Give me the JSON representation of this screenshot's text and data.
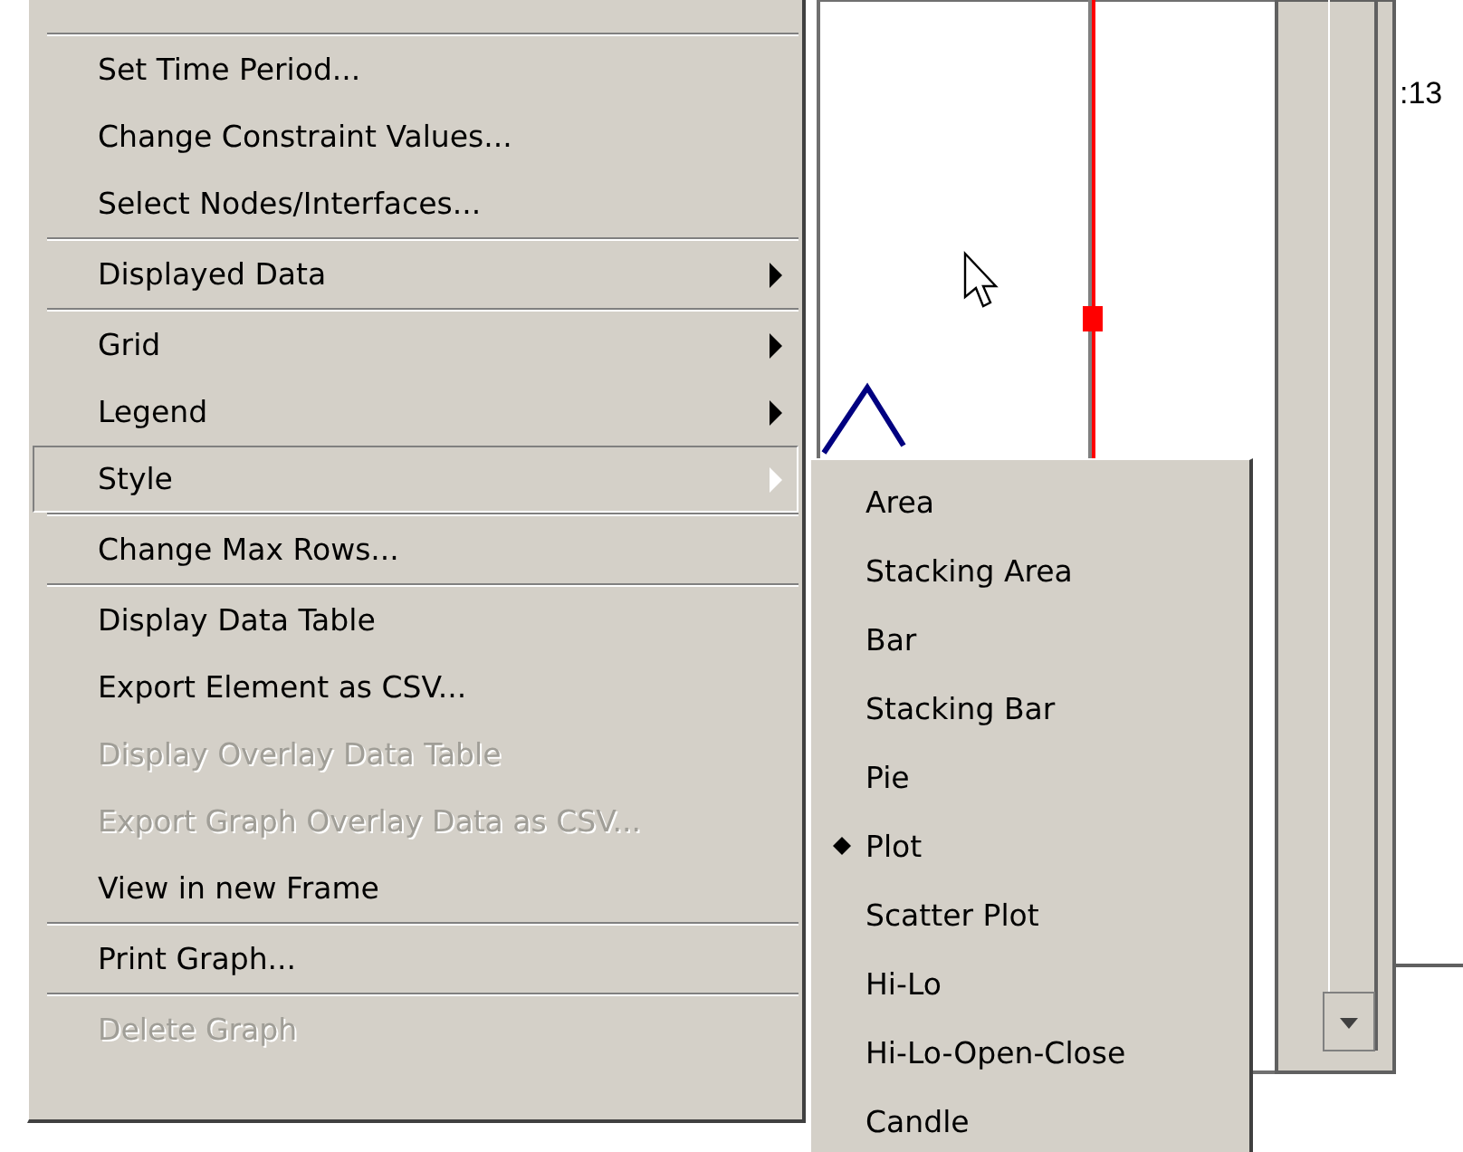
{
  "background": {
    "labels": [
      {
        "text": ":13"
      }
    ]
  },
  "menu": {
    "items": [
      {
        "kind": "separator"
      },
      {
        "kind": "item",
        "label": "Set Time Period...",
        "disabled": false,
        "submenu": false,
        "selected": false
      },
      {
        "kind": "item",
        "label": "Change Constraint Values...",
        "disabled": false,
        "submenu": false,
        "selected": false
      },
      {
        "kind": "item",
        "label": "Select Nodes/Interfaces...",
        "disabled": false,
        "submenu": false,
        "selected": false
      },
      {
        "kind": "separator"
      },
      {
        "kind": "item",
        "label": "Displayed Data",
        "disabled": false,
        "submenu": true,
        "selected": false
      },
      {
        "kind": "separator"
      },
      {
        "kind": "item",
        "label": "Grid",
        "disabled": false,
        "submenu": true,
        "selected": false
      },
      {
        "kind": "item",
        "label": "Legend",
        "disabled": false,
        "submenu": true,
        "selected": false
      },
      {
        "kind": "item",
        "label": "Style",
        "disabled": false,
        "submenu": true,
        "selected": true
      },
      {
        "kind": "separator"
      },
      {
        "kind": "item",
        "label": "Change Max Rows...",
        "disabled": false,
        "submenu": false,
        "selected": false
      },
      {
        "kind": "separator"
      },
      {
        "kind": "item",
        "label": "Display Data Table",
        "disabled": false,
        "submenu": false,
        "selected": false
      },
      {
        "kind": "item",
        "label": "Export Element as CSV...",
        "disabled": false,
        "submenu": false,
        "selected": false
      },
      {
        "kind": "item",
        "label": "Display Overlay Data Table",
        "disabled": true,
        "submenu": false,
        "selected": false
      },
      {
        "kind": "item",
        "label": "Export Graph Overlay Data as CSV...",
        "disabled": true,
        "submenu": false,
        "selected": false
      },
      {
        "kind": "item",
        "label": "View in new Frame",
        "disabled": false,
        "submenu": false,
        "selected": false
      },
      {
        "kind": "separator"
      },
      {
        "kind": "item",
        "label": "Print Graph...",
        "disabled": false,
        "submenu": false,
        "selected": false
      },
      {
        "kind": "separator"
      },
      {
        "kind": "item",
        "label": "Delete Graph",
        "disabled": true,
        "submenu": false,
        "selected": false
      }
    ]
  },
  "submenu": {
    "items": [
      {
        "label": "Area",
        "checked": false
      },
      {
        "label": "Stacking Area",
        "checked": false
      },
      {
        "label": "Bar",
        "checked": false
      },
      {
        "label": "Stacking Bar",
        "checked": false
      },
      {
        "label": "Pie",
        "checked": false
      },
      {
        "label": "Plot",
        "checked": true
      },
      {
        "label": "Scatter Plot",
        "checked": false
      },
      {
        "label": "Hi-Lo",
        "checked": false
      },
      {
        "label": "Hi-Lo-Open-Close",
        "checked": false
      },
      {
        "label": "Candle",
        "checked": false
      }
    ]
  }
}
